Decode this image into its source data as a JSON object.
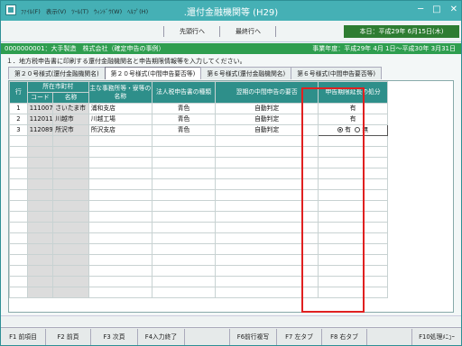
{
  "window": {
    "title": ".還付金融機関等 (H29)",
    "menu": [
      "ﾌｧｲﾙ(F)",
      "表示(V)",
      "ﾂｰﾙ(T)",
      "ｳｨﾝﾄﾞｳ(W)",
      "ﾍﾙﾌﾟ(H)"
    ],
    "controls": {
      "minimize": "─",
      "maximize": "□",
      "close": "✕"
    }
  },
  "toolbar": {
    "first_row": "先頭行へ",
    "last_row": "最終行へ",
    "today": "本日：平成29年 6月15日(木)"
  },
  "info": {
    "company": "0000000001：大手製造　株式会社（確定申告の事例）",
    "fiscal_year": "事業年度：平成29年 4月 1日～平成30年 3月31日"
  },
  "instruction": "１．地方税申告書に印刷する還付金融機関名と申告期限情報等を入力してください。",
  "tabs": [
    "第２０号様式(還付金融機関名)",
    "第２０号様式(中間申告要否等)",
    "第６号様式(還付金融機関名)",
    "第６号様式(中間申告要否等)"
  ],
  "table": {
    "headers": {
      "row": "行",
      "city": "所在市町村",
      "code": "コード",
      "name": "名称",
      "office": "主な事務所等・寮等の名称",
      "filing_type": "法人税申告書の種類",
      "interim": "翌期の中間申告の要否",
      "extension": "申告期限延長の処分"
    },
    "rows": [
      {
        "row": "1",
        "code": "111007",
        "name": "さいたま市",
        "office": "浦和支店",
        "filing_type": "青色",
        "interim": "自動判定",
        "extension": "有"
      },
      {
        "row": "2",
        "code": "112011",
        "name": "川越市",
        "office": "川越工場",
        "filing_type": "青色",
        "interim": "自動判定",
        "extension": "有"
      },
      {
        "row": "3",
        "code": "112089",
        "name": "所沢市",
        "office": "所沢支店",
        "filing_type": "青色",
        "interim": "自動判定",
        "extension_options": [
          "有",
          "無"
        ],
        "extension_selected": "有"
      }
    ]
  },
  "fkeys": [
    "F1 前項目",
    "F2 前頁",
    "F3 次頁",
    "F4入力終了",
    "",
    "F6前行複写",
    "F7 左タブ",
    "F8 右タブ",
    "",
    "F10処理ﾒﾆｭｰ"
  ],
  "colors": {
    "title_bar": "#45b0b5",
    "header": "#2e8f8a",
    "info_bar": "#2e9e4f",
    "highlight": "#e02020"
  }
}
